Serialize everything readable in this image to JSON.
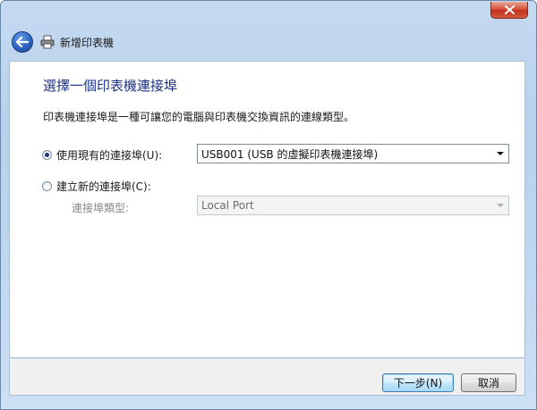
{
  "window": {
    "title": "新增印表機",
    "close_glyph": "✕"
  },
  "icons": {
    "back": "back-arrow-icon",
    "printer": "printer-icon",
    "close": "close-icon",
    "radio": "radio-icon",
    "dropdown": "chevron-down-icon"
  },
  "main": {
    "heading": "選擇一個印表機連接埠",
    "description": "印表機連接埠是一種可讓您的電腦與印表機交換資訊的連線類型。",
    "options": [
      {
        "label": "使用現有的連接埠(U):",
        "selected": true,
        "select_value": "USB001 (USB 的虛擬印表機連接埠)"
      },
      {
        "label": "建立新的連接埠(C):",
        "selected": false
      }
    ],
    "port_type_label": "連接埠類型:",
    "port_type_value": "Local Port"
  },
  "footer": {
    "next_label": "下一步(N)",
    "cancel_label": "取消"
  },
  "colors": {
    "heading": "#1e3287",
    "frame": "#b9d1ec",
    "close": "#c0301d"
  }
}
